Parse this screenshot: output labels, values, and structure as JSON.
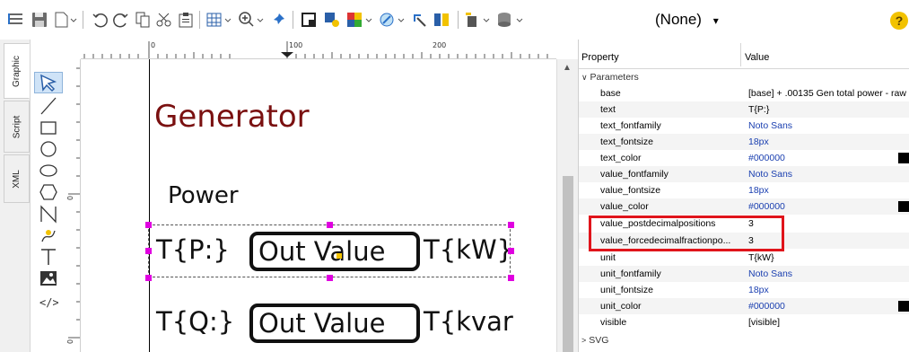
{
  "toolbar": {
    "layer_combo_value": "(None)",
    "icons": [
      "list-icon",
      "save-icon",
      "new-document-icon",
      "undo-icon",
      "redo-icon",
      "copy-icon",
      "cut-icon",
      "paste-icon",
      "grid-icon",
      "zoom-icon",
      "pin-icon",
      "fill-icon",
      "highlight-icon",
      "color-palette-icon",
      "effect-icon",
      "pointer-icon",
      "align-icon",
      "insert-icon",
      "database-icon",
      "help-icon"
    ]
  },
  "side_tabs": [
    "Graphic",
    "Script",
    "XML"
  ],
  "tools": [
    "select-arrow",
    "line",
    "rectangle",
    "circle",
    "ellipse",
    "polygon",
    "polyline",
    "path",
    "text",
    "image",
    "code"
  ],
  "rulers": {
    "h_labels": [
      "0",
      "100",
      "200"
    ],
    "v_labels": [
      "0",
      "0"
    ]
  },
  "canvas": {
    "title": "Generator",
    "power_label": "Power",
    "row1": {
      "left": "T{P:}",
      "value": "Out Value",
      "right": "T{kW}"
    },
    "row2": {
      "left": "T{Q:}",
      "value": "Out Value",
      "right": "T{kvar"
    }
  },
  "properties": {
    "header": {
      "col1": "Property",
      "col2": "Value"
    },
    "group_parameters": "Parameters",
    "rows": [
      {
        "key": "base",
        "value": "[base] + .00135 Gen total power - raw",
        "style": "plain"
      },
      {
        "key": "text",
        "value": "T{P:}",
        "style": "plain"
      },
      {
        "key": "text_fontfamily",
        "value": "Noto Sans",
        "style": "blue"
      },
      {
        "key": "text_fontsize",
        "value": "18px",
        "style": "blue"
      },
      {
        "key": "text_color",
        "value": "#000000",
        "style": "blue",
        "swatch": "#000000"
      },
      {
        "key": "value_fontfamily",
        "value": "Noto Sans",
        "style": "blue"
      },
      {
        "key": "value_fontsize",
        "value": "18px",
        "style": "blue"
      },
      {
        "key": "value_color",
        "value": "#000000",
        "style": "blue",
        "swatch": "#000000"
      },
      {
        "key": "value_postdecimalpositions",
        "value": "3",
        "style": "plain"
      },
      {
        "key": "value_forcedecimalfractionpo...",
        "value": "3",
        "style": "plain"
      },
      {
        "key": "unit",
        "value": "T{kW}",
        "style": "plain"
      },
      {
        "key": "unit_fontfamily",
        "value": "Noto Sans",
        "style": "blue"
      },
      {
        "key": "unit_fontsize",
        "value": "18px",
        "style": "blue"
      },
      {
        "key": "unit_color",
        "value": "#000000",
        "style": "blue",
        "swatch": "#000000"
      },
      {
        "key": "visible",
        "value": "[visible]",
        "style": "plain"
      }
    ],
    "group_svg": "SVG"
  },
  "colors": {
    "title_color": "#7a1010",
    "handle_color": "#e000e0",
    "highlight_box": "#e0141b",
    "value_blue": "#1a3fb0"
  }
}
